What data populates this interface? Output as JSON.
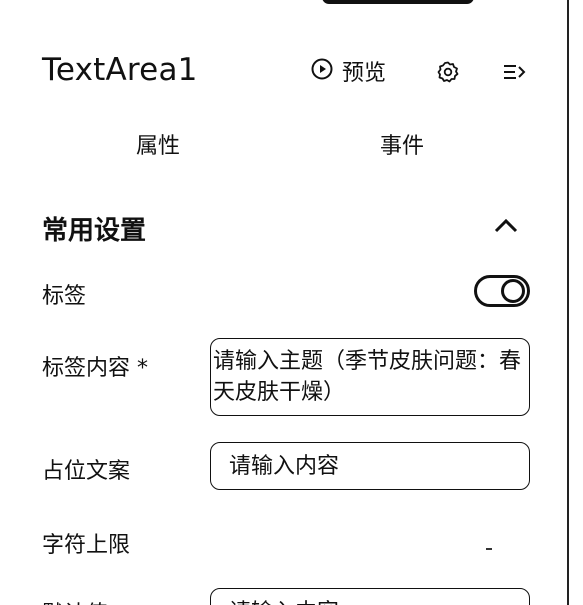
{
  "header": {
    "title": "TextArea1",
    "preview_label": "预览",
    "icons": {
      "preview": "play-circle-icon",
      "settings": "gear-icon",
      "collapse": "collapse-panel-icon"
    }
  },
  "tabs": [
    {
      "label": "属性"
    },
    {
      "label": "事件"
    }
  ],
  "section": {
    "title": "常用设置",
    "chevron": "chevron-up-icon"
  },
  "fields": {
    "tag": {
      "label": "标签",
      "toggle_on": true
    },
    "tag_content": {
      "label": "标签内容 *",
      "value": "请输入主题（季节皮肤问题：春天皮肤干燥）"
    },
    "placeholder": {
      "label": "占位文案",
      "value": "请输入内容"
    },
    "max_length": {
      "label": "字符上限"
    },
    "default_value": {
      "label": "默认值",
      "value": "请输入内容"
    }
  }
}
